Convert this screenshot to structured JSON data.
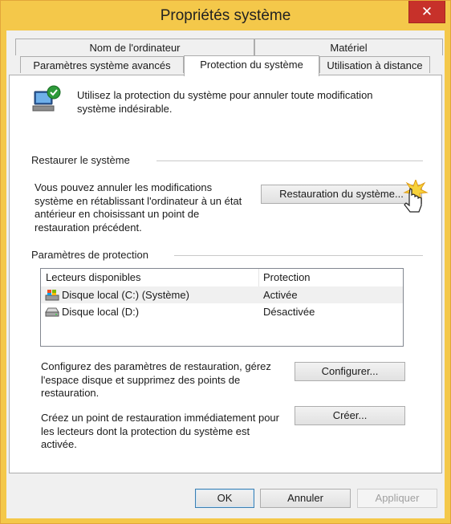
{
  "window": {
    "title": "Propriétés système",
    "close_glyph": "✕"
  },
  "tabs": {
    "row1": [
      {
        "label": "Nom de l'ordinateur"
      },
      {
        "label": "Matériel"
      }
    ],
    "row2": [
      {
        "label": "Paramètres système avancés"
      },
      {
        "label": "Protection du système",
        "active": true
      },
      {
        "label": "Utilisation à distance"
      }
    ]
  },
  "intro": {
    "icon": "system-protection-icon",
    "text_line1": "Utilisez la protection du système pour annuler toute modification",
    "text_line2": "système indésirable."
  },
  "restore": {
    "group_label": "Restaurer le système",
    "description": [
      "Vous pouvez annuler les modifications",
      "système en rétablissant l'ordinateur à un état",
      "antérieur en choisissant un point de",
      "restauration précédent."
    ],
    "button_label": "Restauration du système..."
  },
  "protection": {
    "group_label": "Paramètres de protection",
    "columns": [
      "Lecteurs disponibles",
      "Protection"
    ],
    "drives": [
      {
        "name": "Disque local (C:) (Système)",
        "status": "Activée",
        "icon": "system-drive-icon"
      },
      {
        "name": "Disque local (D:)",
        "status": "Désactivée",
        "icon": "drive-icon"
      }
    ],
    "configure_text": [
      "Configurez des paramètres de restauration, gérez",
      "l'espace disque et supprimez des points de",
      "restauration."
    ],
    "configure_button": "Configurer...",
    "create_text": [
      "Créez un point de restauration immédiatement pour",
      "les lecteurs dont la protection du système est",
      "activée."
    ],
    "create_button": "Créer..."
  },
  "footer": {
    "ok": "OK",
    "cancel": "Annuler",
    "apply": "Appliquer"
  },
  "colors": {
    "frame": "#f4c84a",
    "close": "#c7312a",
    "default_button_border": "#3c7fb1"
  }
}
